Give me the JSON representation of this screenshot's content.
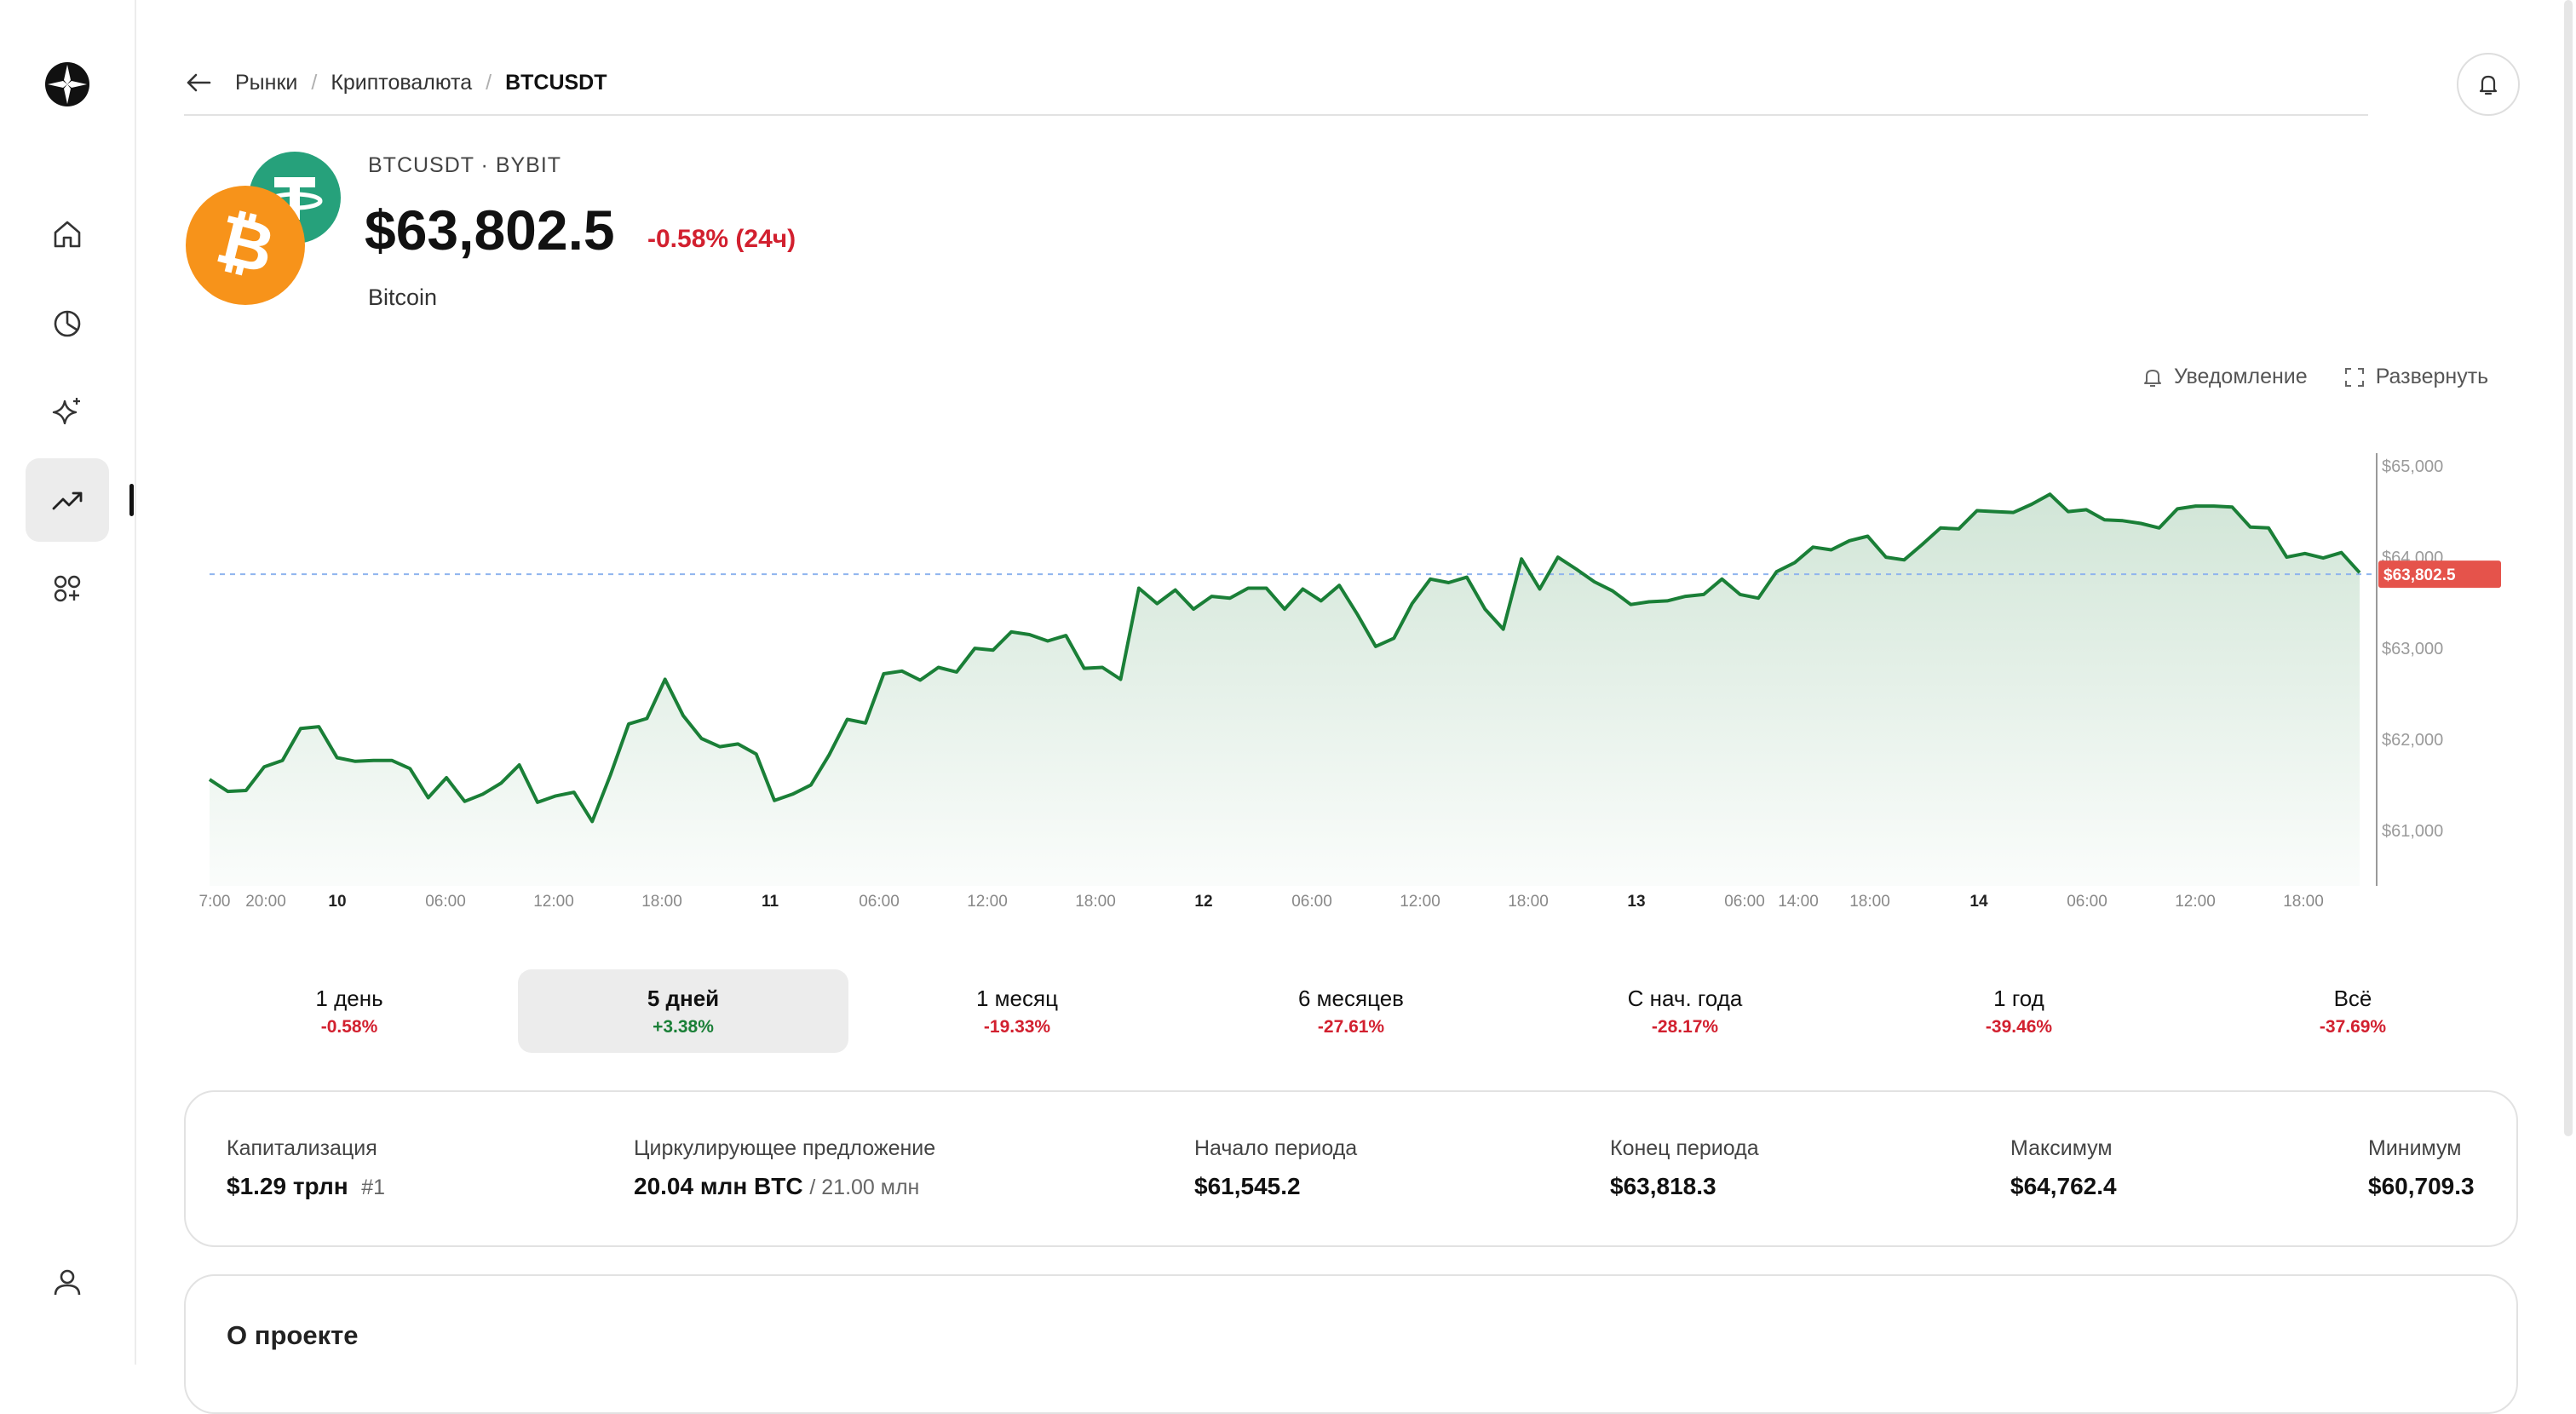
{
  "nav": {
    "items": [
      {
        "name": "home"
      },
      {
        "name": "portfolio"
      },
      {
        "name": "ai-assistant"
      },
      {
        "name": "markets"
      },
      {
        "name": "apps"
      }
    ],
    "profile": "user"
  },
  "breadcrumb": {
    "items": [
      "Рынки",
      "Криптовалюта"
    ],
    "current": "BTCUSDT"
  },
  "asset": {
    "pair": "BTCUSDT · BYBIT",
    "price": "$63,802.5",
    "change": "-0.58% (24ч)",
    "name": "Bitcoin"
  },
  "actions": {
    "notify": "Уведомление",
    "expand": "Развернуть"
  },
  "colors": {
    "line": "#1a7f37",
    "negative": "#d2202f",
    "positive": "#1a7f37",
    "price_tag": "#e5534b"
  },
  "chart_data": {
    "type": "area",
    "current_price_label": "$63,802.5",
    "current_price": 63802.5,
    "y_ticks": [
      "$65,000",
      "$64,000",
      "$63,000",
      "$62,000",
      "$61,000"
    ],
    "ylim": [
      60600,
      65100
    ],
    "x_tick_labels": [
      "7:00",
      "20:00",
      "10",
      "06:00",
      "12:00",
      "18:00",
      "11",
      "06:00",
      "12:00",
      "18:00",
      "12",
      "06:00",
      "12:00",
      "18:00",
      "13",
      "06:00",
      "14:00",
      "18:00",
      "14",
      "06:00",
      "12:00",
      "18:00"
    ],
    "x_tick_bold": [
      false,
      false,
      true,
      false,
      false,
      false,
      true,
      false,
      false,
      false,
      true,
      false,
      false,
      false,
      true,
      false,
      false,
      false,
      true,
      false,
      false,
      false
    ],
    "values": [
      61550,
      61420,
      61430,
      61690,
      61760,
      62110,
      62130,
      61790,
      61750,
      61760,
      61760,
      61670,
      61350,
      61570,
      61310,
      61390,
      61510,
      61710,
      61300,
      61370,
      61410,
      61090,
      61600,
      62160,
      62220,
      62650,
      62250,
      62000,
      61910,
      61940,
      61830,
      61320,
      61390,
      61490,
      61820,
      62210,
      62170,
      62710,
      62740,
      62640,
      62780,
      62730,
      62990,
      62970,
      63170,
      63140,
      63070,
      63130,
      62770,
      62780,
      62650,
      63650,
      63480,
      63630,
      63420,
      63560,
      63540,
      63650,
      63650,
      63420,
      63640,
      63510,
      63680,
      63360,
      63010,
      63100,
      63480,
      63750,
      63710,
      63770,
      63420,
      63200,
      63970,
      63640,
      63990,
      63860,
      63720,
      63620,
      63470,
      63500,
      63510,
      63560,
      63580,
      63750,
      63580,
      63540,
      63830,
      63930,
      64100,
      64070,
      64170,
      64220,
      63990,
      63960,
      64130,
      64310,
      64300,
      64500,
      64490,
      64480,
      64570,
      64680,
      64490,
      64510,
      64400,
      64390,
      64360,
      64310,
      64520,
      64550,
      64550,
      64540,
      64320,
      64310,
      63990,
      64030,
      63980,
      64040,
      63820
    ],
    "grid": false,
    "legend": "none"
  },
  "periods": [
    {
      "label": "1 день",
      "pct": "-0.58%",
      "sign": "neg"
    },
    {
      "label": "5 дней",
      "pct": "+3.38%",
      "sign": "pos",
      "active": true
    },
    {
      "label": "1 месяц",
      "pct": "-19.33%",
      "sign": "neg"
    },
    {
      "label": "6 месяцев",
      "pct": "-27.61%",
      "sign": "neg"
    },
    {
      "label": "С нач. года",
      "pct": "-28.17%",
      "sign": "neg"
    },
    {
      "label": "1 год",
      "pct": "-39.46%",
      "sign": "neg"
    },
    {
      "label": "Всё",
      "pct": "-37.69%",
      "sign": "neg"
    }
  ],
  "stats": {
    "cap_label": "Капитализация",
    "cap_value": "$1.29 трлн",
    "cap_rank": "#1",
    "supply_label": "Циркулирующее предложение",
    "supply_value": "20.04 млн BTC",
    "supply_max": "/ 21.00 млн",
    "start_label": "Начало периода",
    "start_value": "$61,545.2",
    "end_label": "Конец периода",
    "end_value": "$63,818.3",
    "max_label": "Максимум",
    "max_value": "$64,762.4",
    "min_label": "Минимум",
    "min_value": "$60,709.3"
  },
  "about": {
    "title": "О проекте"
  }
}
